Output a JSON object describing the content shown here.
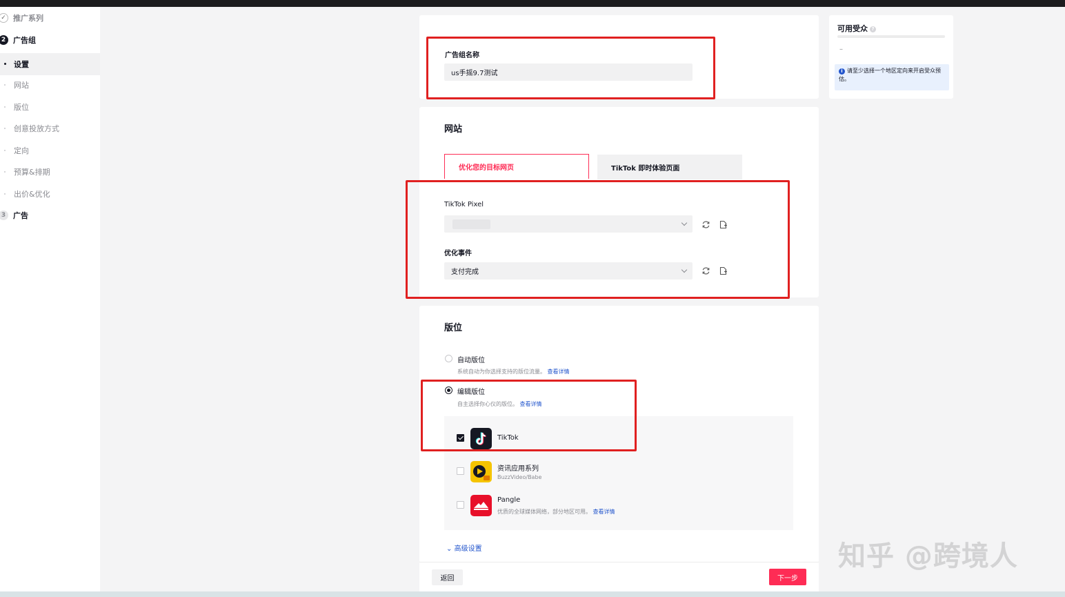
{
  "sidebar": {
    "steps": [
      {
        "num": "✓",
        "label": "推广系列"
      },
      {
        "num": "2",
        "label": "广告组"
      },
      {
        "num": "3",
        "label": "广告"
      }
    ],
    "items": [
      {
        "label": "设置"
      },
      {
        "label": "网站"
      },
      {
        "label": "版位"
      },
      {
        "label": "创意投放方式"
      },
      {
        "label": "定向"
      },
      {
        "label": "预算&排期"
      },
      {
        "label": "出价&优化"
      }
    ]
  },
  "adgroup": {
    "name_label": "广告组名称",
    "name_value": "us手摇9.7测试"
  },
  "website": {
    "title": "网站",
    "tabs": [
      {
        "label": "优化您的目标网页"
      },
      {
        "label": "TikTok 即时体验页面"
      }
    ],
    "pixel_label": "TikTok Pixel",
    "event_label": "优化事件",
    "event_value": "支付完成"
  },
  "placement": {
    "title": "版位",
    "auto_label": "自动版位",
    "auto_desc": "系统自动为你选择支持的版位流量。",
    "edit_label": "编辑版位",
    "edit_desc": "自主选择你心仪的版位。",
    "details_link": "查看详情",
    "platforms": [
      {
        "name": "TikTok",
        "sub": "",
        "checked": true
      },
      {
        "name": "资讯应用系列",
        "sub": "BuzzVideo/Babe",
        "checked": false
      },
      {
        "name": "Pangle",
        "sub": "优质的全球媒体网络，部分地区可用。",
        "checked": false
      }
    ],
    "advanced": "高级设置"
  },
  "footer": {
    "back": "返回",
    "next": "下一步"
  },
  "audience": {
    "title": "可用受众",
    "value": "–",
    "info": "请至少选择一个地区定向来开启受众预估。"
  },
  "watermark": "知乎 @跨境人",
  "colors": {
    "accent": "#fe2c55",
    "highlight_box": "#e02020",
    "link": "#2255cc"
  }
}
